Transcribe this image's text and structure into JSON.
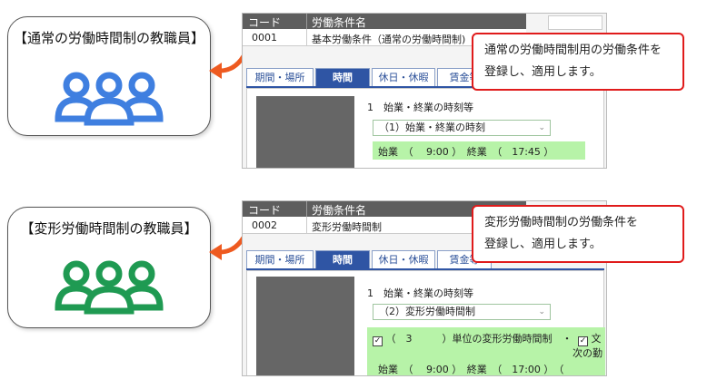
{
  "sections": [
    {
      "card_title": "【通常の労働時間制の教職員】",
      "people_color": "#3f7fe0",
      "table": {
        "col_code": "コード",
        "col_name": "労働条件名",
        "code": "0001",
        "name": "基本労働条件（通常の労働時間制)"
      },
      "tabs": [
        "期間・場所",
        "時間",
        "休日・休暇",
        "賃金等"
      ],
      "active_tab": "時間",
      "section_heading": "1　始業・終業の時刻等",
      "select_value": "（1）始業・終業の時刻",
      "rows": [
        {
          "text": "始業　（　  9:00 ）　終業　（　17:45 ）"
        }
      ],
      "callout_lines": [
        "通常の労働時間制用の労働条件を",
        "登録し、適用します。"
      ]
    },
    {
      "card_title": "【変形労働時間制の教職員】",
      "people_color": "#1f9a52",
      "table": {
        "col_code": "コード",
        "col_name": "労働条件名",
        "code": "0002",
        "name": "変形労働時間制"
      },
      "tabs": [
        "期間・場所",
        "時間",
        "休日・休暇",
        "賃金等"
      ],
      "active_tab": "時間",
      "section_heading": "1　始業・終業の時刻等",
      "select_value": "（2）変形労働時間制",
      "rows": [
        {
          "text": "（　3　　　）単位の変形労働時間制　・",
          "checkbox": "✓"
        },
        {
          "text": "文",
          "checkbox": "✓"
        },
        {
          "text": "次の勤"
        },
        {
          "text": "始業　（　  9:00 ）　終業　（　17:00 ）　（"
        }
      ],
      "callout_lines": [
        "変形労働時間制の労働条件を",
        "登録し、適用します。"
      ]
    }
  ],
  "accent_red": "#e01b1b",
  "tab_blue": "#2f55a4"
}
